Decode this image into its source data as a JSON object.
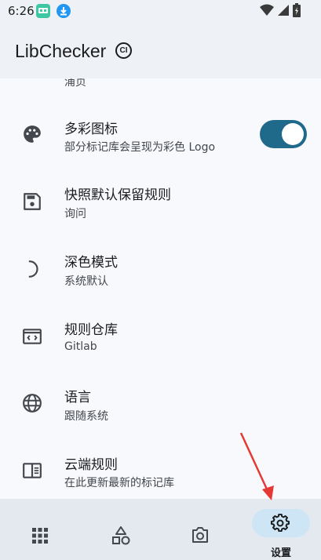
{
  "status_bar": {
    "time": "6:26",
    "icons": [
      "app-notification-icon",
      "download-icon",
      "wifi-icon",
      "signal-icon",
      "battery-icon"
    ]
  },
  "app_bar": {
    "title": "LibChecker",
    "badge": "CI"
  },
  "settings": {
    "partial_subtitle": "浦贞",
    "items": [
      {
        "title": "多彩图标",
        "subtitle": "部分标记库会呈现为彩色 Logo",
        "icon": "palette-icon",
        "toggle": true
      },
      {
        "title": "快照默认保留规则",
        "subtitle": "询问",
        "icon": "save-icon"
      },
      {
        "title": "深色模式",
        "subtitle": "系统默认",
        "icon": "dark-mode-icon"
      },
      {
        "title": "规则仓库",
        "subtitle": "Gitlab",
        "icon": "code-window-icon"
      },
      {
        "title": "语言",
        "subtitle": "跟随系统",
        "icon": "globe-icon"
      },
      {
        "title": "云端规则",
        "subtitle": "在此更新最新的标记库",
        "icon": "book-icon"
      }
    ]
  },
  "bottom_nav": {
    "items": [
      {
        "name": "apps",
        "icon": "grid-icon"
      },
      {
        "name": "statistics",
        "icon": "shapes-icon"
      },
      {
        "name": "snapshot",
        "icon": "camera-icon"
      },
      {
        "name": "settings",
        "icon": "gear-icon",
        "label": "设置",
        "selected": true
      }
    ]
  },
  "colors": {
    "accent": "#1f6a8a",
    "nav_selected_pill": "#cde5f4",
    "annotation_arrow": "#e53935"
  }
}
